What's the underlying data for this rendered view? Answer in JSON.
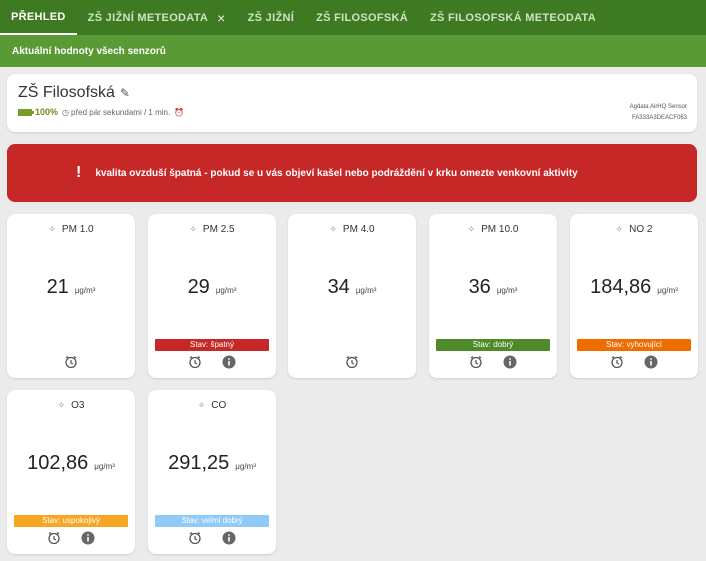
{
  "nav": {
    "tabs": [
      {
        "label": "PŘEHLED",
        "active": true
      },
      {
        "label": "ZŠ JIŽNÍ METEODATA",
        "close": "×"
      },
      {
        "label": "ZŠ JIŽNÍ"
      },
      {
        "label": "ZŠ FILOSOFSKÁ"
      },
      {
        "label": "ZŠ FILOSOFSKÁ METEODATA"
      }
    ]
  },
  "subbar": {
    "label": "Aktuální hodnoty všech senzorů"
  },
  "header": {
    "title": "ZŠ Filosofská",
    "battery_pct": "100%",
    "status": "před pár sekundami / 1 min.",
    "device_name": "Agdata AirHQ Sensor",
    "device_id": "FA333A3DEACF063"
  },
  "alert": {
    "message": "kvalita ovzduší špatná - pokud se u vás objeví kašel nebo podráždění v krku omezte venkovní aktivity"
  },
  "sensors": [
    {
      "name": "PM 1.0",
      "value": "21",
      "unit": "μg/m³",
      "status": "",
      "status_color": ""
    },
    {
      "name": "PM 2.5",
      "value": "29",
      "unit": "μg/m³",
      "status": "Stav: špatný",
      "status_color": "#c62828"
    },
    {
      "name": "PM 4.0",
      "value": "34",
      "unit": "μg/m³",
      "status": "",
      "status_color": ""
    },
    {
      "name": "PM 10.0",
      "value": "36",
      "unit": "μg/m³",
      "status": "Stav: dobrý",
      "status_color": "#4e8a2a"
    },
    {
      "name": "NO 2",
      "value": "184,86",
      "unit": "μg/m³",
      "status": "Stav: vyhovující",
      "status_color": "#ef6c00"
    },
    {
      "name": "O3",
      "value": "102,86",
      "unit": "μg/m³",
      "status": "Stav: uspokojivý",
      "status_color": "#f6a623"
    },
    {
      "name": "CO",
      "value": "291,25",
      "unit": "μg/m³",
      "status": "Stav: velmi dobrý",
      "status_color": "#90caf9"
    }
  ]
}
